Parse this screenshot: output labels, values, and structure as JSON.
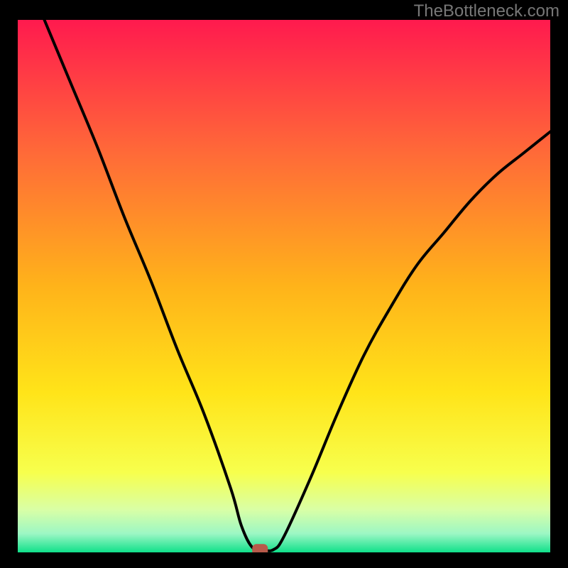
{
  "watermark": "TheBottleneck.com",
  "chart_data": {
    "type": "line",
    "title": "",
    "xlabel": "",
    "ylabel": "",
    "xlim": [
      0,
      100
    ],
    "ylim": [
      0,
      100
    ],
    "series": [
      {
        "name": "curve",
        "x": [
          5,
          10,
          15,
          20,
          25,
          30,
          35,
          40,
          42,
          44,
          46,
          48,
          50,
          55,
          60,
          65,
          70,
          75,
          80,
          85,
          90,
          95,
          100
        ],
        "values": [
          100,
          88,
          76,
          63,
          51,
          38,
          26,
          12,
          5,
          1,
          0.5,
          0.5,
          3,
          14,
          26,
          37,
          46,
          54,
          60,
          66,
          71,
          75,
          79
        ]
      }
    ],
    "marker": {
      "x": 45.5,
      "y": 0.5
    },
    "gradient_stops": [
      {
        "offset": 0.0,
        "color": "#ff1a4e"
      },
      {
        "offset": 0.25,
        "color": "#ff6a38"
      },
      {
        "offset": 0.5,
        "color": "#ffb31a"
      },
      {
        "offset": 0.7,
        "color": "#ffe419"
      },
      {
        "offset": 0.85,
        "color": "#f7ff4d"
      },
      {
        "offset": 0.92,
        "color": "#d9ffa6"
      },
      {
        "offset": 0.965,
        "color": "#9cf7c4"
      },
      {
        "offset": 1.0,
        "color": "#10e08a"
      }
    ]
  }
}
